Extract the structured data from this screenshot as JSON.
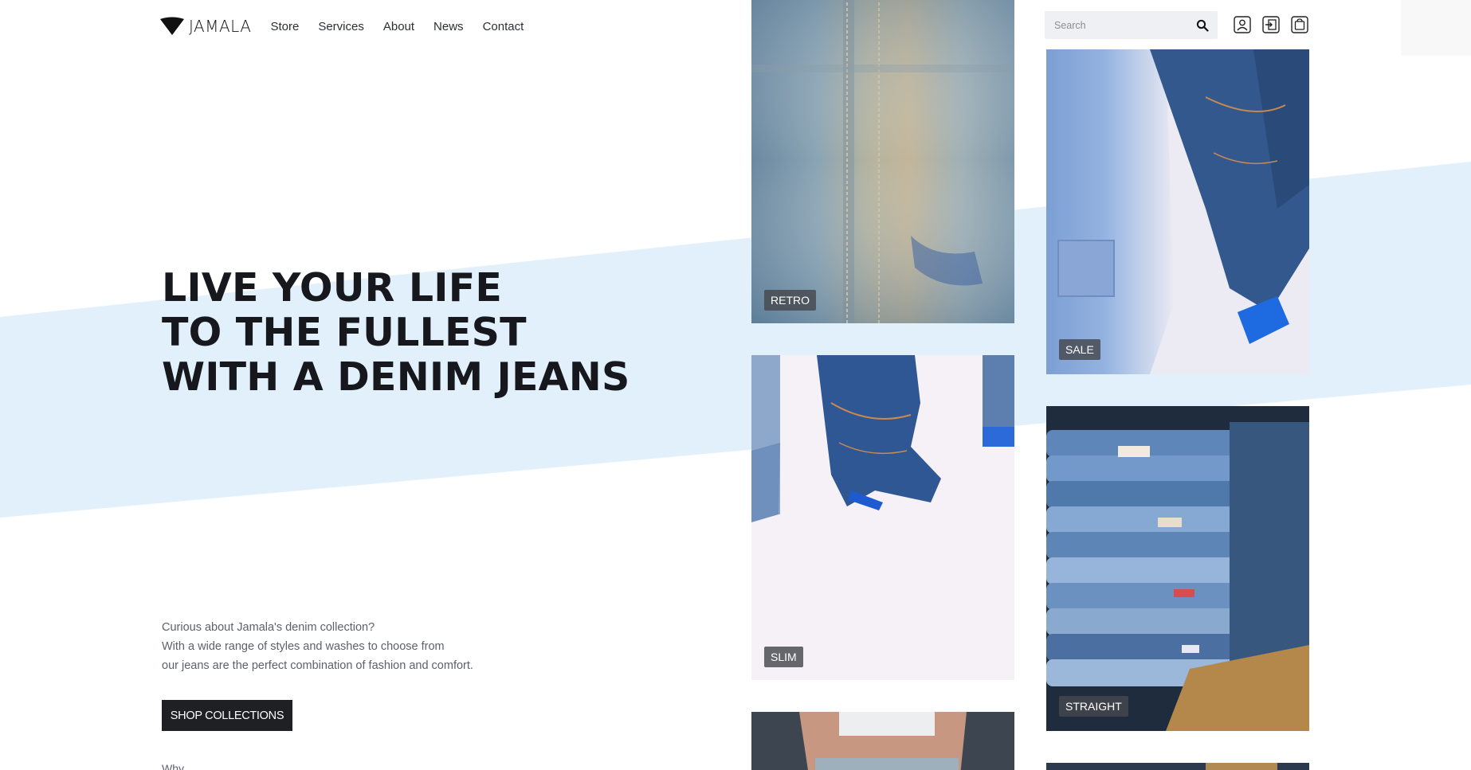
{
  "brand": {
    "name": "JAMALA"
  },
  "nav": {
    "links": [
      "Store",
      "Services",
      "About",
      "News",
      "Contact"
    ]
  },
  "hero": {
    "title_lines": [
      "LIVE YOUR LIFE",
      "TO THE FULLEST",
      "WITH A DENIM JEANS"
    ],
    "description_lines": [
      "Curious about Jamala's denim collection?",
      "With a wide range of styles and washes to choose from",
      "our jeans are the perfect combination of fashion and comfort."
    ],
    "cta_label": "SHOP COLLECTIONS",
    "next_section_label": "Why"
  },
  "search": {
    "placeholder": "Search"
  },
  "header_icons": [
    "account-icon",
    "login-icon",
    "cart-icon"
  ],
  "tiles": [
    {
      "label": "RETRO",
      "photo": "faded-denim-fabric-closeup"
    },
    {
      "label": "SLIM",
      "photo": "jeans-hanging-on-white-wall"
    },
    {
      "label": "SALE",
      "photo": "light-jeans-hanging-blurred"
    },
    {
      "label": "STRAIGHT",
      "photo": "folded-jeans-stack-on-shelf"
    }
  ],
  "colors": {
    "accent_stripe": "#e1f0fb",
    "cta_background": "#1e2024",
    "text_dark": "#16181d",
    "text_muted": "#5d616a",
    "tag_background": "#46484e"
  }
}
